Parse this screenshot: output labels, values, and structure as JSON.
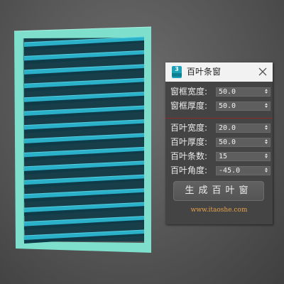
{
  "dialog": {
    "title": "百叶条窗",
    "app_icon_label": "3",
    "close_icon": "close-icon"
  },
  "frame_params": [
    {
      "label": "窗框宽度:",
      "value": "50.0"
    },
    {
      "label": "窗框厚度:",
      "value": "50.0"
    }
  ],
  "louver_params": [
    {
      "label": "百叶宽度:",
      "value": "20.0"
    },
    {
      "label": "百叶厚度:",
      "value": "50.0"
    },
    {
      "label": "百叶条数:",
      "value": "15"
    },
    {
      "label": "百叶角度:",
      "value": "-45.0"
    }
  ],
  "generate_label": "生成百叶窗",
  "website": "www.itaoshe.com",
  "colors": {
    "frame": "#7ee0cc",
    "slat_top": "#2ab0c9",
    "slat_dark": "#0f3a48",
    "url": "#e6a14a",
    "separator": "#8b2a2a"
  }
}
